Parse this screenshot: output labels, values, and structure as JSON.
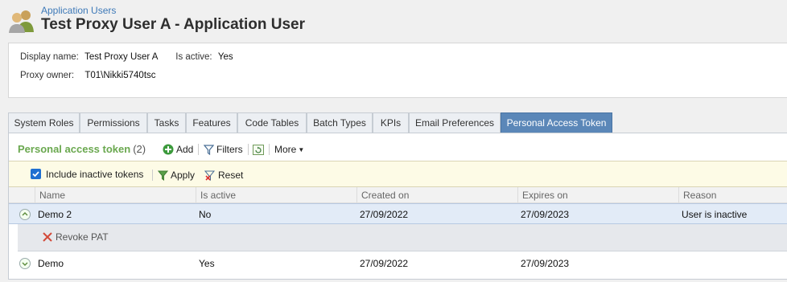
{
  "header": {
    "breadcrumb": "Application Users",
    "title": "Test Proxy User A - Application User"
  },
  "details": {
    "display_name_label": "Display name:",
    "display_name_value": "Test Proxy User A",
    "is_active_label": "Is active:",
    "is_active_value": "Yes",
    "proxy_owner_label": "Proxy owner:",
    "proxy_owner_value": "T01\\Nikki5740tsc"
  },
  "tabs": [
    {
      "label": "System Roles"
    },
    {
      "label": "Permissions"
    },
    {
      "label": "Tasks"
    },
    {
      "label": "Features"
    },
    {
      "label": "Code Tables"
    },
    {
      "label": "Batch Types"
    },
    {
      "label": "KPIs"
    },
    {
      "label": "Email Preferences"
    },
    {
      "label": "Personal Access Token",
      "active": true
    }
  ],
  "toolbar": {
    "title": "Personal access token",
    "count": "(2)",
    "add_label": "Add",
    "filters_label": "Filters",
    "more_label": "More"
  },
  "filterbar": {
    "include_inactive_label": "Include inactive tokens",
    "include_inactive_checked": true,
    "apply_label": "Apply",
    "reset_label": "Reset"
  },
  "grid": {
    "columns": [
      "Name",
      "Is active",
      "Created on",
      "Expires on",
      "Reason"
    ],
    "rows": [
      {
        "name": "Demo 2",
        "is_active": "No",
        "created_on": "27/09/2022",
        "expires_on": "27/09/2023",
        "reason": "User is inactive"
      },
      {
        "name": "Demo",
        "is_active": "Yes",
        "created_on": "27/09/2022",
        "expires_on": "27/09/2023",
        "reason": ""
      }
    ],
    "detail_action_label": "Revoke PAT"
  },
  "colors": {
    "active_tab": "#5b87b8",
    "section_title": "#6aa84f",
    "link": "#2f6fab",
    "filter_bg": "#fdfbe6",
    "selected_row": "#e2ebf7"
  }
}
